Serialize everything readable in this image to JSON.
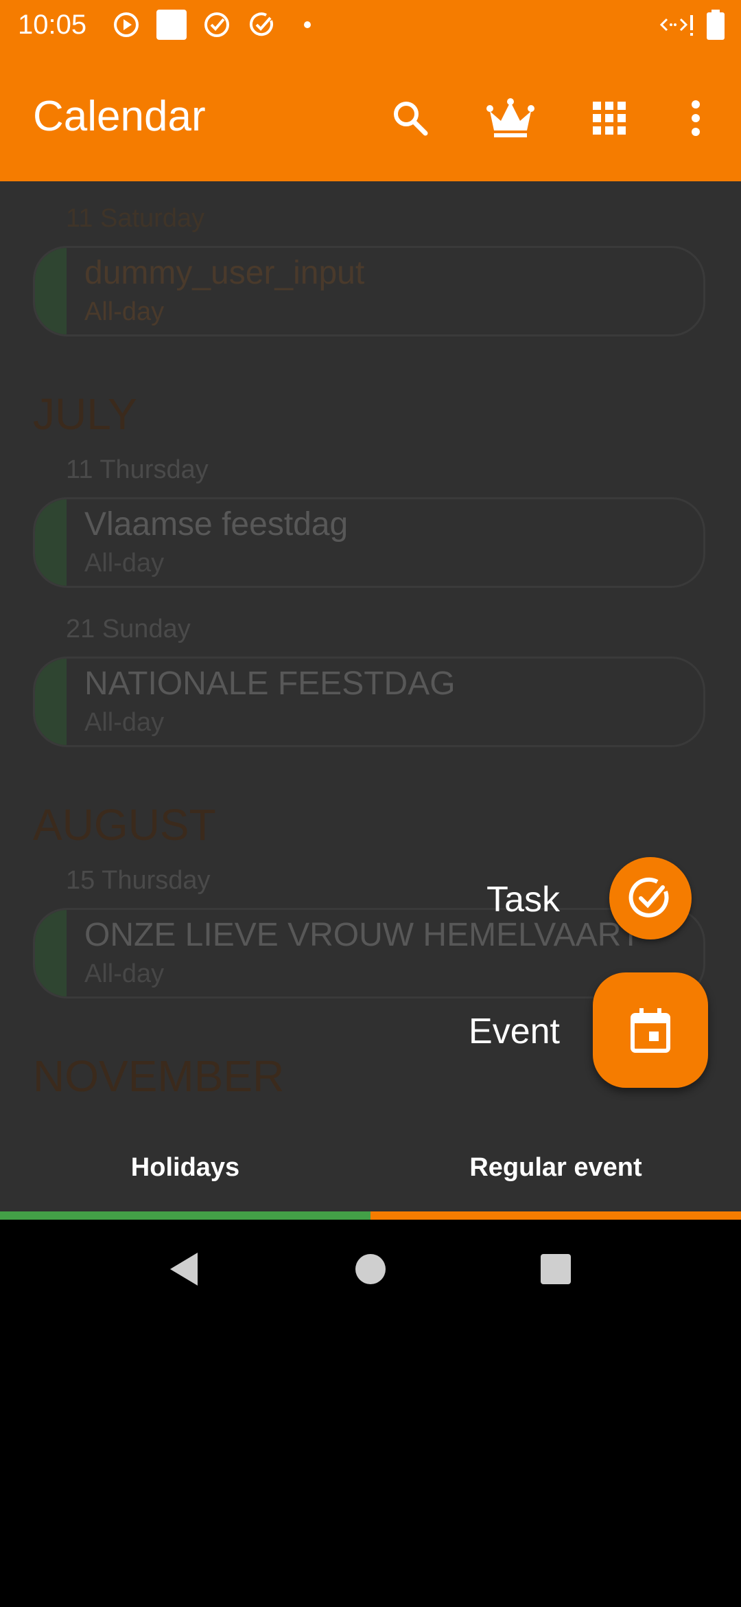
{
  "status_bar": {
    "time": "10:05",
    "icons": [
      "play-circle-icon",
      "white-square-icon",
      "target-check-icon",
      "check-circle-icon",
      "dot-icon",
      "signal-icon",
      "battery-icon"
    ]
  },
  "app_bar": {
    "title": "Calendar",
    "actions": [
      "search-icon",
      "crown-icon",
      "grid-icon",
      "more-vert-icon"
    ]
  },
  "agenda": {
    "sections": [
      {
        "day": "11 Saturday",
        "events": [
          {
            "title": "dummy_user_input",
            "time": "All-day"
          }
        ]
      },
      {
        "month": "JULY",
        "days": [
          {
            "day": "11 Thursday",
            "events": [
              {
                "title": "Vlaamse feestdag",
                "time": "All-day"
              }
            ]
          },
          {
            "day": "21 Sunday",
            "events": [
              {
                "title": "NATIONALE FEESTDAG",
                "time": "All-day"
              }
            ]
          }
        ]
      },
      {
        "month": "AUGUST",
        "days": [
          {
            "day": "15 Thursday",
            "events": [
              {
                "title": "ONZE LIEVE VROUW HEMELVAART",
                "time": "All-day"
              }
            ]
          }
        ]
      },
      {
        "month": "NOVEMBER"
      }
    ]
  },
  "fab_menu": {
    "task_label": "Task",
    "event_label": "Event"
  },
  "tabs": [
    {
      "label": "Holidays",
      "color": "#43A047"
    },
    {
      "label": "Regular event",
      "color": "#F57C00"
    }
  ],
  "colors": {
    "accent": "#F57C00",
    "background": "#303030",
    "holiday": "#43A047"
  },
  "nav_bar": [
    "back-icon",
    "home-icon",
    "recents-icon"
  ]
}
